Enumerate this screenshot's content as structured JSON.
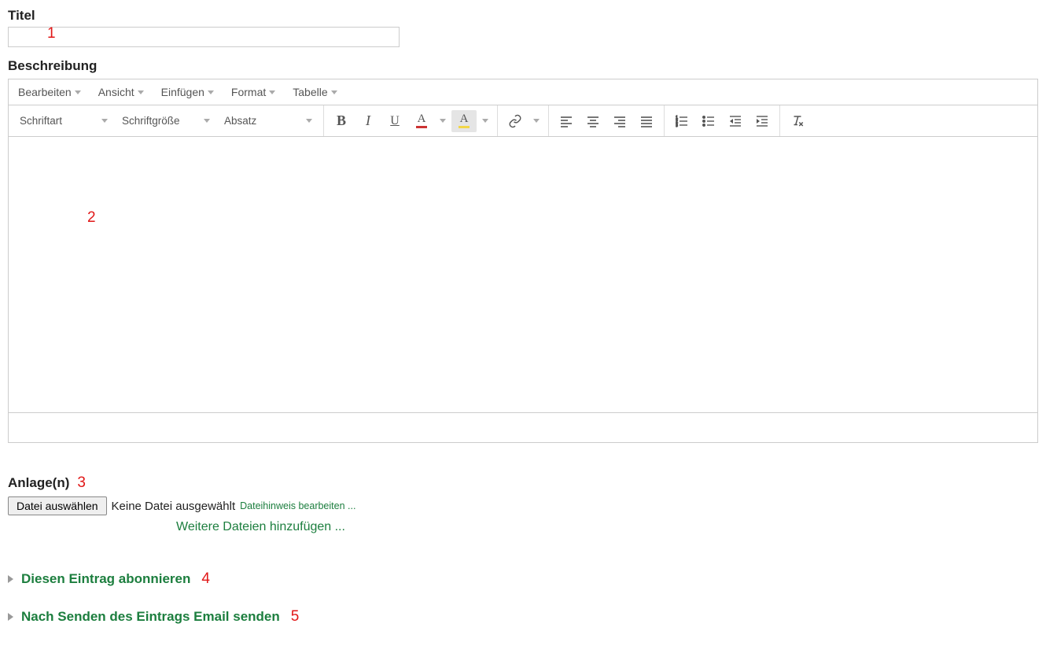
{
  "labels": {
    "title": "Titel",
    "description": "Beschreibung",
    "attachments": "Anlage(n)"
  },
  "title_input": {
    "value": ""
  },
  "editor": {
    "menus": {
      "edit": "Bearbeiten",
      "view": "Ansicht",
      "insert": "Einfügen",
      "format": "Format",
      "table": "Tabelle"
    },
    "selects": {
      "font": "Schriftart",
      "size": "Schriftgröße",
      "block": "Absatz"
    },
    "content": ""
  },
  "attachments": {
    "choose_button": "Datei auswählen",
    "no_file": "Keine Datei ausgewählt",
    "edit_hint": "Dateihinweis bearbeiten ...",
    "add_more": "Weitere Dateien hinzufügen ..."
  },
  "accordion": {
    "subscribe": "Diesen Eintrag abonnieren",
    "send_email": "Nach Senden des Eintrags Email senden"
  },
  "annotations": {
    "a1": "1",
    "a2": "2",
    "a3": "3",
    "a4": "4",
    "a5": "5"
  }
}
